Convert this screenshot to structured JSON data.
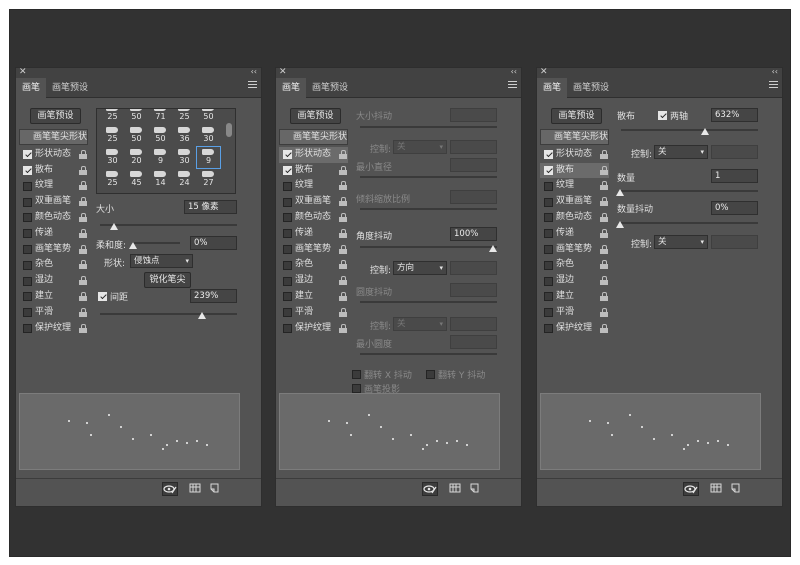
{
  "tabs": {
    "brush": "画笔",
    "presets": "画笔预设"
  },
  "preset_button": "画笔预设",
  "tip_shape": "画笔笔尖形状",
  "left_items": [
    "形状动态",
    "散布",
    "纹理",
    "双重画笔",
    "颜色动态",
    "传递",
    "画笔笔势",
    "杂色",
    "湿边",
    "建立",
    "平滑",
    "保护纹理"
  ],
  "panel1": {
    "checked": [
      true,
      true,
      false,
      false,
      false,
      false,
      false,
      false,
      false,
      false,
      false,
      false
    ],
    "grid_rows": [
      [
        "25",
        "50",
        "71",
        "25",
        "50"
      ],
      [
        "25",
        "50",
        "50",
        "36",
        "30"
      ],
      [
        "30",
        "20",
        "9",
        "30",
        "9"
      ],
      [
        "25",
        "45",
        "14",
        "24",
        "27"
      ]
    ],
    "size_label": "大小",
    "size_value": "15 像素",
    "hardness_label": "柔和度:",
    "hardness_value": "0%",
    "shape_label": "形状:",
    "shape_value": "侵蚀点",
    "sharpen_button": "锐化笔尖",
    "spacing_label": "间距",
    "spacing_value": "239%"
  },
  "panel2": {
    "checked": [
      true,
      true,
      false,
      false,
      false,
      false,
      false,
      false,
      false,
      false,
      false,
      false
    ],
    "size_jitter": "大小抖动",
    "control": "控制:",
    "off": "关",
    "min_diameter": "最小直径",
    "tilt_scale": "倾斜缩放比例",
    "angle_jitter": "角度抖动",
    "angle_value": "100%",
    "direction": "方向",
    "roundness_jitter": "圆度抖动",
    "min_roundness": "最小圆度",
    "flip_x": "翻转 X 抖动",
    "flip_y": "翻转 Y 抖动",
    "brush_projection": "画笔投影"
  },
  "panel3": {
    "checked": [
      true,
      true,
      false,
      false,
      false,
      false,
      false,
      false,
      false,
      false,
      false,
      false
    ],
    "scatter_label": "散布",
    "both_axes": "两轴",
    "scatter_value": "632%",
    "control": "控制:",
    "off": "关",
    "count_label": "数量",
    "count_value": "1",
    "count_jitter": "数量抖动",
    "count_jitter_value": "0%"
  }
}
